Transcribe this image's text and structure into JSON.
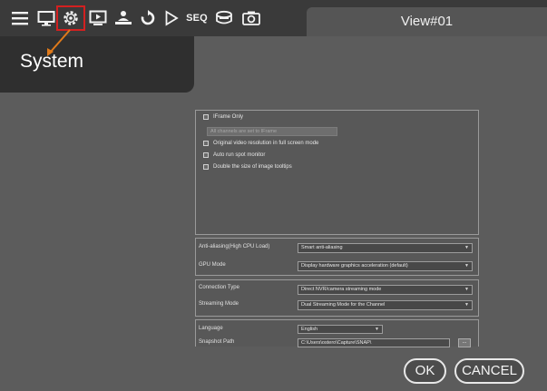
{
  "toolbar": {
    "icons": [
      "menu-icon",
      "monitor-icon",
      "gear-icon",
      "playback-icon",
      "network-icon",
      "sync-icon",
      "play-icon",
      "seq-icon",
      "storage-icon",
      "camera-icon"
    ],
    "seq_label": "SEQ",
    "highlight_color": "#d32020"
  },
  "view_tab": {
    "title": "View#01"
  },
  "system_panel": {
    "label": "System",
    "arrow_color": "#e07a1a"
  },
  "display_options": {
    "iframe_only": {
      "label": "IFrame Only",
      "checked": false
    },
    "iframe_select": {
      "value": "All channels are set to IFrame"
    },
    "original_resolution": {
      "label": "Original video resolution in full screen mode",
      "checked": false
    },
    "auto_spot_monitor": {
      "label": "Auto run spot monitor",
      "checked": false
    },
    "double_tooltips": {
      "label": "Double the size of image tooltips",
      "checked": false
    }
  },
  "render_options": {
    "anti_aliasing": {
      "label": "Anti-aliasing(High CPU Load)",
      "value": "Smart anti-aliasing"
    },
    "gpu_mode": {
      "label": "GPU Mode",
      "value": "Display hardware graphics acceleration (default)"
    }
  },
  "connection_options": {
    "connection_type": {
      "label": "Connection Type",
      "value": "Direct NVR/camera streaming mode"
    },
    "streaming_mode": {
      "label": "Streaming Mode",
      "value": "Dual Streaming Mode for the Channel"
    }
  },
  "general_options": {
    "language": {
      "label": "Language",
      "value": "English"
    },
    "snapshot_path": {
      "label": "Snapshot Path",
      "value": "C:\\Users\\ostero\\Capture\\SNAP\\",
      "browse_label": "..."
    }
  },
  "buttons": {
    "ok": "OK",
    "cancel": "CANCEL"
  }
}
